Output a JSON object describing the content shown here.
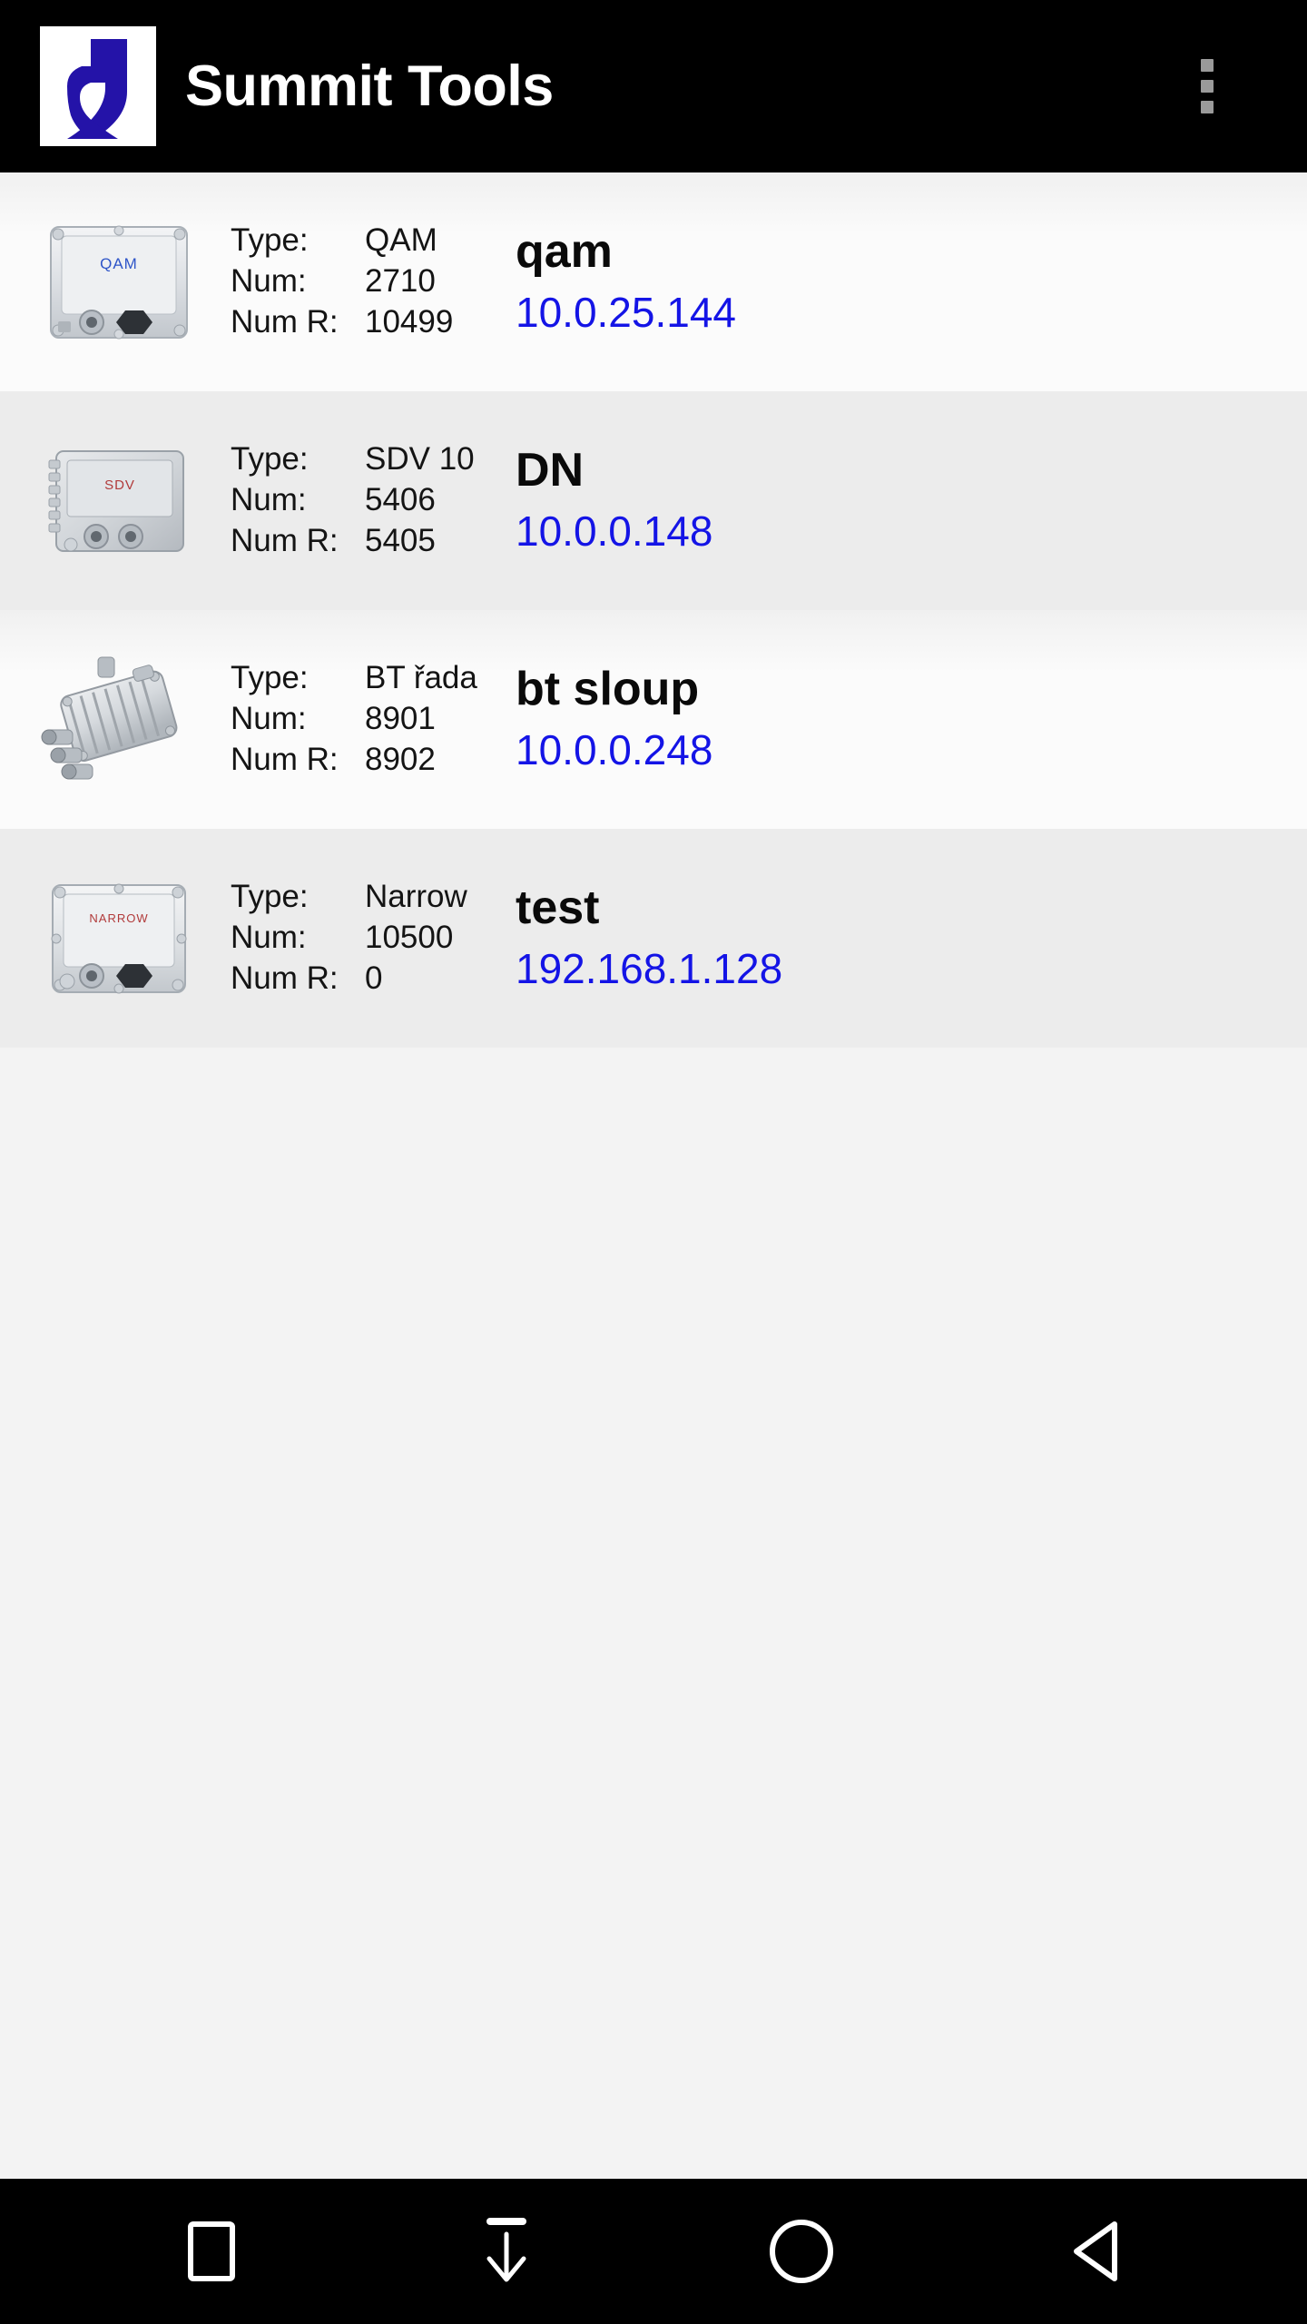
{
  "appbar": {
    "title": "Summit Tools",
    "logo_alt": "summit-logo",
    "logo_bg": "#ffffff",
    "logo_fg": "#2413a8",
    "background": "#000000",
    "overflow_label": "More options"
  },
  "labels": {
    "type": "Type:",
    "num": "Num:",
    "num_r": "Num R:"
  },
  "colors": {
    "ip_link": "#1414e6",
    "row_odd": "#fbfbfb",
    "row_even": "#ececec",
    "name_text": "#0a0a0a"
  },
  "devices": [
    {
      "thumb": "qam-device-thumbnail",
      "thumb_caption": "QAM",
      "type": "QAM",
      "num": "2710",
      "num_r": "10499",
      "name": "qam",
      "ip": "10.0.25.144"
    },
    {
      "thumb": "sdv-device-thumbnail",
      "thumb_caption": "SDV",
      "type": "SDV 10",
      "num": "5406",
      "num_r": "5405",
      "name": "DN",
      "ip": "10.0.0.148"
    },
    {
      "thumb": "bt-amplifier-thumbnail",
      "thumb_caption": "",
      "type": "BT řada",
      "num": "8901",
      "num_r": "8902",
      "name": "bt sloup",
      "ip": "10.0.0.248"
    },
    {
      "thumb": "narrow-device-thumbnail",
      "thumb_caption": "NARROW",
      "type": "Narrow",
      "num": "10500",
      "num_r": "0",
      "name": "test",
      "ip": "192.168.1.128"
    }
  ],
  "navbar": {
    "background": "#000000",
    "buttons": [
      {
        "icon": "recents-square-icon",
        "label": "Recents"
      },
      {
        "icon": "hide-keyboard-down-arrow-icon",
        "label": "Hide keyboard"
      },
      {
        "icon": "home-circle-icon",
        "label": "Home"
      },
      {
        "icon": "back-triangle-icon",
        "label": "Back"
      }
    ]
  }
}
